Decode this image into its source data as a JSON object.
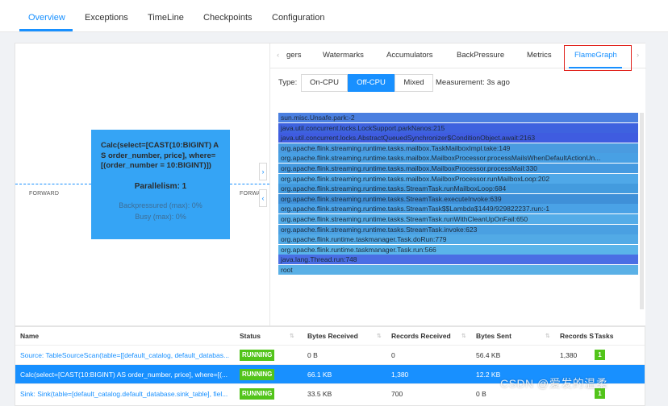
{
  "top_tabs": [
    "Overview",
    "Exceptions",
    "TimeLine",
    "Checkpoints",
    "Configuration"
  ],
  "graph": {
    "left_edge_label": "FORWARD",
    "right_edge_label": "FORWA",
    "node": {
      "title": "Calc(select=[CAST(10:BIGINT) AS order_number, price], where=[(order_number = 10:BIGINT)])",
      "parallelism": "Parallelism: 1",
      "backpressured": "Backpressured (max): 0%",
      "busy": "Busy (max): 0%",
      "color": "#35a4f5"
    }
  },
  "sub_tabs": {
    "scroll_left": "‹",
    "items": [
      "gers",
      "Watermarks",
      "Accumulators",
      "BackPressure",
      "Metrics",
      "FlameGraph"
    ],
    "scroll_right": "›",
    "active": "FlameGraph"
  },
  "flame_controls": {
    "type_label": "Type:",
    "options": [
      "On-CPU",
      "Off-CPU",
      "Mixed"
    ],
    "selected": "Off-CPU",
    "measurement": "Measurement: 3s ago"
  },
  "flame_frames": [
    {
      "label": "sun.misc.Unsafe.park:-2",
      "color": "#4a7fe0"
    },
    {
      "label": "java.util.concurrent.locks.LockSupport.parkNanos:215",
      "color": "#3e62df"
    },
    {
      "label": "java.util.concurrent.locks.AbstractQueuedSynchronizer$ConditionObject.await:2163",
      "color": "#3f5ce0"
    },
    {
      "label": "org.apache.flink.streaming.runtime.tasks.mailbox.TaskMailboxImpl.take:149",
      "color": "#4a9be0"
    },
    {
      "label": "org.apache.flink.streaming.runtime.tasks.mailbox.MailboxProcessor.processMailsWhenDefaultActionUn...",
      "color": "#48a0e4"
    },
    {
      "label": "org.apache.flink.streaming.runtime.tasks.mailbox.MailboxProcessor.processMail:330",
      "color": "#459ae0"
    },
    {
      "label": "org.apache.flink.streaming.runtime.tasks.mailbox.MailboxProcessor.runMailboxLoop:202",
      "color": "#4fa8e8"
    },
    {
      "label": "org.apache.flink.streaming.runtime.tasks.StreamTask.runMailboxLoop:684",
      "color": "#439bde"
    },
    {
      "label": "org.apache.flink.streaming.runtime.tasks.StreamTask.executeInvoke:639",
      "color": "#3f90d8"
    },
    {
      "label": "org.apache.flink.streaming.runtime.tasks.StreamTask$$Lambda$1449/929822237.run:-1",
      "color": "#4aa2e6"
    },
    {
      "label": "org.apache.flink.streaming.runtime.tasks.StreamTask.runWithCleanUpOnFail:650",
      "color": "#54ace8"
    },
    {
      "label": "org.apache.flink.streaming.runtime.tasks.StreamTask.invoke:623",
      "color": "#4aa0e2"
    },
    {
      "label": "org.apache.flink.runtime.taskmanager.Task.doRun:779",
      "color": "#52aae6"
    },
    {
      "label": "org.apache.flink.runtime.taskmanager.Task.run:566",
      "color": "#5ab4ea"
    },
    {
      "label": "java.lang.Thread.run:748",
      "color": "#4a6ee4"
    },
    {
      "label": "root",
      "color": "#5ab0e6"
    }
  ],
  "table": {
    "headers": [
      "Name",
      "Status",
      "Bytes Received",
      "Records Received",
      "Bytes Sent",
      "Records S",
      "Tasks"
    ],
    "rows": [
      {
        "name": "Source: TableSourceScan(table=[[default_catalog, default_databas...",
        "status": "RUNNING",
        "bytes_received": "0 B",
        "records_received": "0",
        "bytes_sent": "56.4 KB",
        "records_sent": "1,380",
        "tasks": "1",
        "selected": false
      },
      {
        "name": "Calc(select=[CAST(10:BIGINT) AS order_number, price], where=[(...",
        "status": "RUNNING",
        "bytes_received": "66.1 KB",
        "records_received": "1,380",
        "bytes_sent": "12.2 KB",
        "records_sent": "",
        "tasks": "",
        "selected": true
      },
      {
        "name": "Sink: Sink(table=[default_catalog.default_database.sink_table], fiel...",
        "status": "RUNNING",
        "bytes_received": "33.5 KB",
        "records_received": "700",
        "bytes_sent": "0 B",
        "records_sent": "",
        "tasks": "1",
        "selected": false
      }
    ]
  },
  "watermark": "CSDN @爱发的温柔"
}
